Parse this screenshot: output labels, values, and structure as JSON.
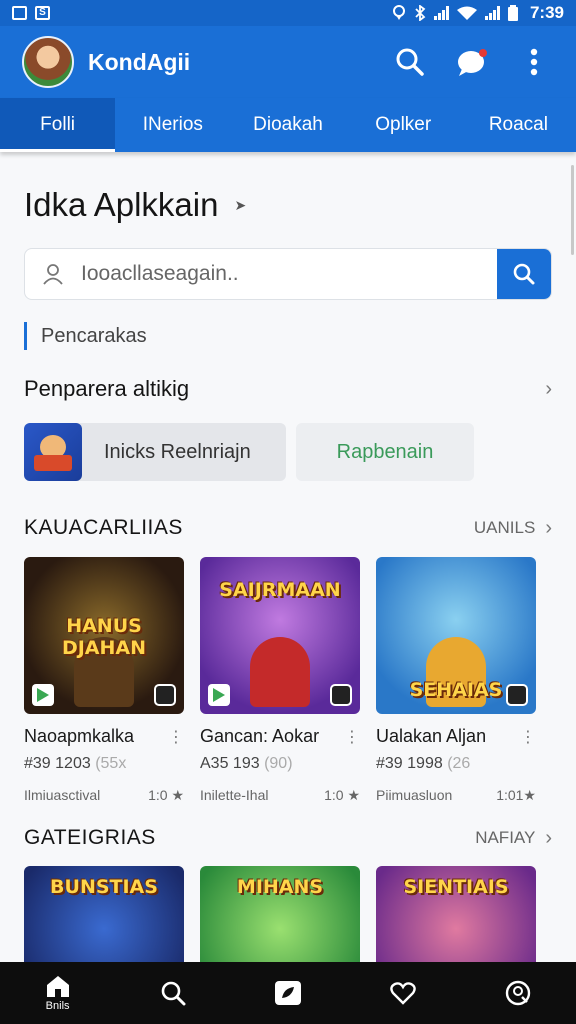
{
  "status_bar": {
    "time": "7:39"
  },
  "app_bar": {
    "title": "KondAgii"
  },
  "tabs": [
    {
      "label": "Folli",
      "active": true
    },
    {
      "label": "INerios",
      "active": false
    },
    {
      "label": "Dioakah",
      "active": false
    },
    {
      "label": "Oplker",
      "active": false
    },
    {
      "label": "Roacal",
      "active": false
    }
  ],
  "main": {
    "heading": "Idka Aplkkain",
    "search": {
      "placeholder": "Iooacllaseagain.."
    },
    "subsection": "Pencarakas",
    "featured": {
      "title": "Penparera altikig",
      "pill_primary": "Inicks Reelnriajn",
      "pill_secondary": "Rapbenain"
    },
    "section1": {
      "title": "KAUACARLIIAS",
      "more_label": "UANILS",
      "cards": [
        {
          "thumb_text": "HANUS DJAHAN",
          "name": "Naoapmkalka",
          "id_main": "#39 1203",
          "id_faded": "(55x",
          "meta_left": "Ilmiuasctival",
          "meta_right": "1:0 ★"
        },
        {
          "thumb_text": "SAIJRMAAN",
          "name": "Gancan: Aokar",
          "id_main": "A35 193",
          "id_faded": "(90)",
          "meta_left": "Inilette-Ihal",
          "meta_right": "1:0 ★"
        },
        {
          "thumb_text": "SEHAIAS",
          "name": "Ualakan Aljan",
          "id_main": "#39 1998",
          "id_faded": "(26",
          "meta_left": "Piimuasluon",
          "meta_right": "1:01★"
        }
      ]
    },
    "section2": {
      "title": "GATEIGRIAS",
      "more_label": "NAFIAY",
      "cards": [
        {
          "thumb_text": "BUNSTIAS"
        },
        {
          "thumb_text": "MIHANS"
        },
        {
          "thumb_text": "SIENTIAIS"
        }
      ]
    }
  },
  "bottom_nav": {
    "home_label": "Bnils"
  },
  "colors": {
    "primary": "#1a6fd6",
    "tab_active": "#1059b8",
    "green_text": "#3a9a5a"
  }
}
